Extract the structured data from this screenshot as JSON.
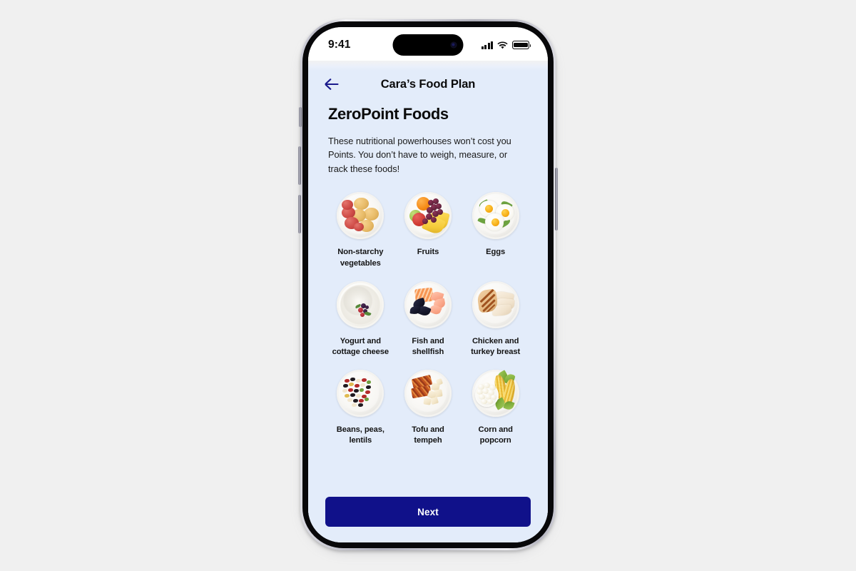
{
  "status_bar": {
    "time": "9:41",
    "signal_icon": "cellular-signal-icon",
    "wifi_icon": "wifi-icon",
    "battery_icon": "battery-icon"
  },
  "nav": {
    "back_icon": "back-arrow-icon",
    "title": "Cara’s Food Plan"
  },
  "page": {
    "title": "ZeroPoint Foods",
    "description": "These nutritional powerhouses won’t cost you Points. You don’t have to weigh, measure, or track these foods!"
  },
  "foods": [
    {
      "label": "Non-starchy vegetables",
      "icon": "potatoes-plate-image"
    },
    {
      "label": "Fruits",
      "icon": "fruits-plate-image"
    },
    {
      "label": "Eggs",
      "icon": "fried-eggs-plate-image"
    },
    {
      "label": "Yogurt and cottage cheese",
      "icon": "yogurt-bowl-image"
    },
    {
      "label": "Fish and shellfish",
      "icon": "fish-shellfish-plate-image"
    },
    {
      "label": "Chicken and turkey breast",
      "icon": "chicken-turkey-plate-image"
    },
    {
      "label": "Beans, peas, lentils",
      "icon": "beans-plate-image"
    },
    {
      "label": "Tofu and tempeh",
      "icon": "tofu-tempeh-plate-image"
    },
    {
      "label": "Corn and popcorn",
      "icon": "corn-popcorn-plate-image"
    }
  ],
  "footer": {
    "next_label": "Next"
  },
  "colors": {
    "app_background": "#e3ecfa",
    "primary_button": "#10118a",
    "accent_navy": "#1a1a8c",
    "text_primary": "#0b0b0b",
    "page_background": "#f0f0f0"
  }
}
